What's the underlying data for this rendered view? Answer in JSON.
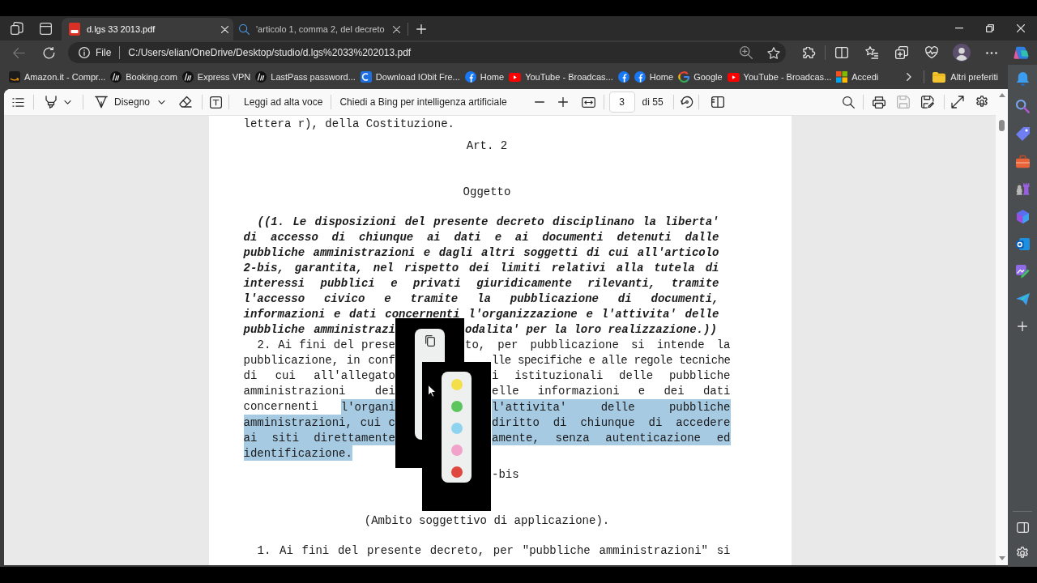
{
  "tabs": [
    {
      "title": "d.lgs 33 2013.pdf",
      "kind": "pdf",
      "selected": true
    },
    {
      "title": "'articolo 1, comma 2, del decreto",
      "kind": "search",
      "selected": false
    }
  ],
  "navigation": {
    "back_disabled": true
  },
  "address_bar": {
    "site_info": "File",
    "url": "C:/Users/elian/OneDrive/Desktop/studio/d.lgs%2033%202013.pdf"
  },
  "bookmarks": [
    {
      "label": "Amazon.it - Compr...",
      "kind": "smile"
    },
    {
      "label": "Booking.com",
      "kind": "round_logo"
    },
    {
      "label": "Express VPN",
      "kind": "round_logo"
    },
    {
      "label": "LastPass password...",
      "kind": "round_logo"
    },
    {
      "label": "Download IObit Fre...",
      "kind": "crescent"
    },
    {
      "label": "Home",
      "kind": "f_circle"
    },
    {
      "label": "YouTube - Broadcas...",
      "kind": "play"
    },
    {
      "kind": "f_circle"
    },
    {
      "label": "Home",
      "kind": "f_circle"
    },
    {
      "label": "Google",
      "kind": "g_ring"
    },
    {
      "label": "YouTube - Broadcas...",
      "kind": "play"
    },
    {
      "label": "Accedi",
      "kind": "squares"
    }
  ],
  "other_favorites": "Altri preferiti",
  "pdf_toolbar": {
    "draw_label": "Disegno",
    "read_aloud_label": "Leggi ad alta voce",
    "ask_ai_label": "Chiedi a Bing per intelligenza artificiale",
    "page_number": "3",
    "page_count": "di 55",
    "save_disabled": true
  },
  "document": {
    "blocks": [
      {
        "kind": "paragraph",
        "bold_italic": false,
        "first_line_indented": false,
        "continues": false,
        "lines": [
          {
            "kind": "full",
            "segments": [
              {
                "text": "lettera r), della Costituzione.",
                "highlighted": false
              }
            ]
          }
        ]
      },
      {
        "kind": "article",
        "lines": [
          {
            "kind": "full",
            "segments": [
              {
                "text": "Art. 2",
                "highlighted": false
              }
            ]
          }
        ]
      },
      {
        "kind": "subtitle",
        "lines": [
          {
            "kind": "full",
            "segments": [
              {
                "text": "Oggetto",
                "highlighted": false
              }
            ]
          }
        ]
      },
      {
        "kind": "paragraph",
        "bold_italic": true,
        "first_line_indented": true,
        "continues": false,
        "lines": [
          {
            "kind": "full",
            "segments": [
              {
                "text": "((1. Le disposizioni del presente decreto disciplinano la liberta'",
                "highlighted": false
              }
            ]
          },
          {
            "kind": "full",
            "segments": [
              {
                "text": "di accesso di chiunque ai dati e ai documenti detenuti dalle",
                "highlighted": false
              }
            ]
          },
          {
            "kind": "full",
            "segments": [
              {
                "text": "pubbliche amministrazioni e dagli altri soggetti di cui all'articolo",
                "highlighted": false
              }
            ]
          },
          {
            "kind": "full",
            "segments": [
              {
                "text": "2-bis, garantita, nel rispetto dei limiti relativi alla tutela di",
                "highlighted": false
              }
            ]
          },
          {
            "kind": "full",
            "segments": [
              {
                "text": "interessi pubblici e privati giuridicamente rilevanti, tramite",
                "highlighted": false
              }
            ]
          },
          {
            "kind": "full",
            "segments": [
              {
                "text": "l'accesso civico e tramite la pubblicazione di documenti,",
                "highlighted": false
              }
            ]
          },
          {
            "kind": "full",
            "segments": [
              {
                "text": "informazioni e dati concernenti l'organizzazione e l'attivita' delle",
                "highlighted": false
              }
            ]
          },
          {
            "kind": "split",
            "left": [
              {
                "text": "pubbliche amministrazi",
                "highlighted": false
              }
            ],
            "right": [
              {
                "text": "odalita' per la loro realizzazione.))",
                "highlighted": false
              }
            ]
          }
        ]
      },
      {
        "kind": "paragraph",
        "bold_italic": false,
        "first_line_indented": true,
        "continues": false,
        "lines": [
          {
            "kind": "split",
            "left": [
              {
                "text": "2. Ai fini del prese",
                "highlighted": false
              }
            ],
            "right": [
              {
                "text": "to, per pubblicazione si intende la",
                "highlighted": false
              }
            ]
          },
          {
            "kind": "split",
            "left": [
              {
                "text": "pubblicazione, in conf",
                "highlighted": false
              }
            ],
            "right": [
              {
                "text": "lle specifiche e alle regole tecniche",
                "highlighted": false
              }
            ]
          },
          {
            "kind": "split",
            "left": [
              {
                "text": "di cui all'allegato",
                "highlighted": false
              }
            ],
            "right": [
              {
                "text": "i istituzionali delle pubbliche",
                "highlighted": false
              }
            ]
          },
          {
            "kind": "split",
            "left": [
              {
                "text": "amministrazioni dei",
                "highlighted": false
              }
            ],
            "right": [
              {
                "text": "elle informazioni e dei dati",
                "highlighted": false
              }
            ]
          },
          {
            "kind": "split",
            "left": [
              {
                "text": "concernenti",
                "highlighted": false
              },
              {
                "text": "l'organi",
                "highlighted": true
              }
            ],
            "right": [
              {
                "text": "l'attivita' delle pubbliche",
                "highlighted": true
              }
            ]
          },
          {
            "kind": "split",
            "left": [
              {
                "text": "amministrazioni, cui c",
                "highlighted": true
              }
            ],
            "right": [
              {
                "text": "diritto di chiunque di accedere",
                "highlighted": true
              }
            ]
          },
          {
            "kind": "split",
            "left": [
              {
                "text": "ai siti direttamente",
                "highlighted": true
              }
            ],
            "right": [
              {
                "text": "amente, senza autenticazione ed",
                "highlighted": true
              }
            ]
          },
          {
            "kind": "full",
            "segments": [
              {
                "text": "identificazione.",
                "highlighted": true
              }
            ]
          }
        ]
      },
      {
        "kind": "article",
        "lines": [
          {
            "kind": "split",
            "right": [
              {
                "text": "-bis",
                "highlighted": false
              }
            ]
          }
        ]
      },
      {
        "kind": "subtitle",
        "lines": [
          {
            "kind": "full",
            "segments": [
              {
                "text": "(Ambito soggettivo di applicazione).",
                "highlighted": false
              }
            ]
          }
        ]
      },
      {
        "kind": "paragraph",
        "bold_italic": false,
        "first_line_indented": true,
        "continues": true,
        "lines": [
          {
            "kind": "full",
            "segments": [
              {
                "text": "1. Ai fini del presente decreto, per \"pubbliche amministrazioni\" si",
                "highlighted": false
              }
            ]
          }
        ]
      }
    ]
  },
  "highlight_menu": {
    "colors": [
      {
        "color": "#f2df4a"
      },
      {
        "color": "#5cc65c"
      },
      {
        "color": "#8fd4ef"
      },
      {
        "color": "#f2a3cc"
      },
      {
        "color": "#e0473f"
      }
    ]
  }
}
